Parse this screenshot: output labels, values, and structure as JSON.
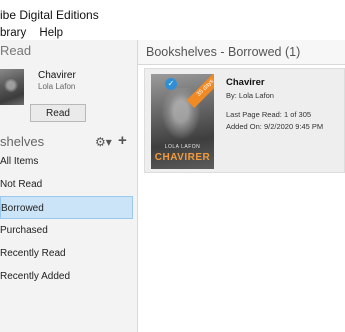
{
  "window": {
    "title": "ibe Digital Editions"
  },
  "menu": {
    "items": [
      "brary",
      "Help"
    ]
  },
  "last_read": {
    "heading": "Read",
    "book_title": "Chavirer",
    "book_author": "Lola Lafon",
    "read_button": "Read"
  },
  "bookshelves": {
    "heading": "shelves",
    "items": [
      {
        "label": "All Items"
      },
      {
        "label": "Not Read"
      },
      {
        "label": "Borrowed"
      },
      {
        "label": "Purchased"
      },
      {
        "label": "Recently Read"
      },
      {
        "label": "Recently Added"
      }
    ],
    "selected": "Borrowed"
  },
  "main": {
    "title": "Bookshelves - Borrowed (1)",
    "book": {
      "title": "Chavirer",
      "author": "By: Lola Lafon",
      "last_page": "Last Page Read: 1 of 305",
      "added_on": "Added On: 9/2/2020 9:45 PM",
      "cover_author": "LOLA LAFON",
      "cover_title": "CHAVIRER",
      "ribbon": "35 days"
    }
  },
  "colors": {
    "selection_bg": "#cce4f7",
    "selection_border": "#99c9ef",
    "cover_title": "#f29a3c",
    "ribbon": "#f08a24"
  }
}
